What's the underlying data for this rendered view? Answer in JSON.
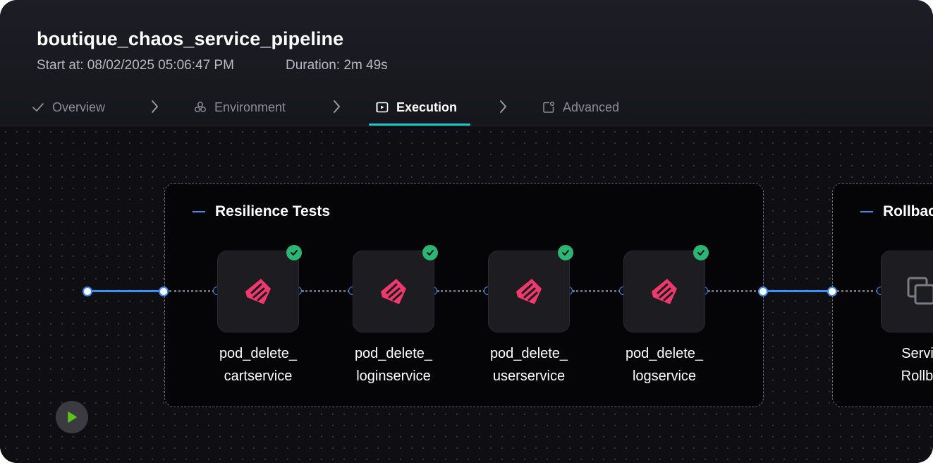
{
  "pipeline": {
    "title": "boutique_chaos_service_pipeline",
    "start_at": "Start at: 08/02/2025 05:06:47 PM",
    "duration": "Duration: 2m 49s"
  },
  "tabs": [
    {
      "label": "Overview",
      "icon": "checkmark-icon",
      "state": "completed"
    },
    {
      "label": "Environment",
      "icon": "environment-icon",
      "state": "default"
    },
    {
      "label": "Execution",
      "icon": "execution-icon",
      "state": "active"
    },
    {
      "label": "Advanced",
      "icon": "advanced-icon",
      "state": "default"
    }
  ],
  "groups": [
    {
      "title": "Resilience Tests",
      "nodes": [
        {
          "line1": "pod_delete_",
          "line2": "cartservice",
          "status": "success",
          "icon": "chaos-icon"
        },
        {
          "line1": "pod_delete_",
          "line2": "loginservice",
          "status": "success",
          "icon": "chaos-icon"
        },
        {
          "line1": "pod_delete_",
          "line2": "userservice",
          "status": "success",
          "icon": "chaos-icon"
        },
        {
          "line1": "pod_delete_",
          "line2": "logservice",
          "status": "success",
          "icon": "chaos-icon"
        }
      ]
    },
    {
      "title": "Rollbac",
      "nodes": [
        {
          "line1": "Servic",
          "line2": "Rollba",
          "icon": "copy-icon"
        }
      ]
    }
  ],
  "colors": {
    "accent_tab": "#1ec8c0",
    "edge_active": "#3b8ff0",
    "success": "#2bb673",
    "chaos_icon": "#f0386e",
    "start_play": "#5fc21a"
  }
}
